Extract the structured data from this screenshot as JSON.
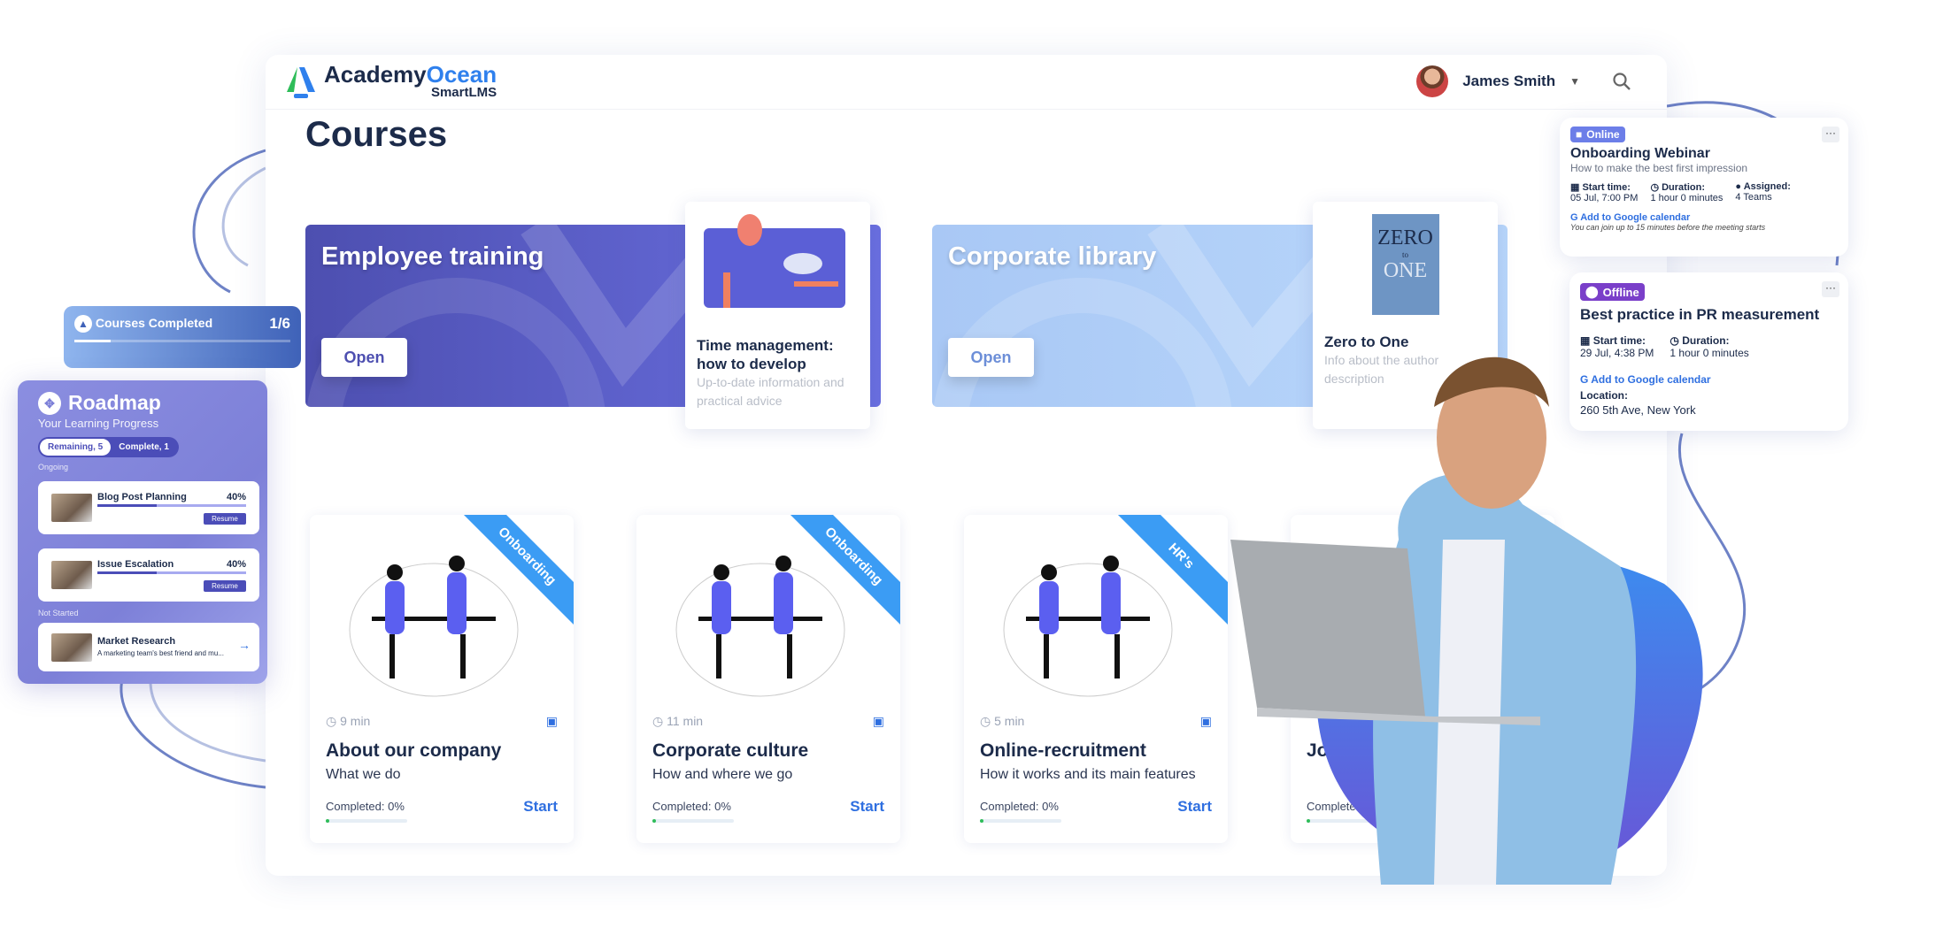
{
  "brand": {
    "name_a": "Academy",
    "name_b": "Ocean",
    "sub": "SmartLMS"
  },
  "header": {
    "user_name": "James Smith"
  },
  "page": {
    "title": "Courses"
  },
  "banners": [
    {
      "title": "Employee training",
      "open_label": "Open",
      "color": "#5b5fd6",
      "featured": {
        "title": "Time management: how to develop",
        "desc": "Up-to-date information and practical advice"
      }
    },
    {
      "title": "Corporate library",
      "open_label": "Open",
      "color": "#a9ccf7",
      "featured": {
        "title": "Zero to One",
        "desc": "Info about the author description",
        "cover_top": "ZERO",
        "cover_mid": "to",
        "cover_bottom": "ONE"
      }
    }
  ],
  "courses": [
    {
      "tag": "Onboarding",
      "duration": "9 min",
      "title": "About our company",
      "subtitle": "What we do",
      "completed": "Completed: 0%",
      "progress": 0,
      "action": "Start"
    },
    {
      "tag": "Onboarding",
      "duration": "11 min",
      "title": "Corporate culture",
      "subtitle": "How and where we go",
      "completed": "Completed: 0%",
      "progress": 0,
      "action": "Start"
    },
    {
      "tag": "HR's",
      "duration": "5 min",
      "title": "Online-recruitment",
      "subtitle": "How it works and its main features",
      "completed": "Completed: 0%",
      "progress": 0,
      "action": "Start"
    },
    {
      "title": "Job",
      "completed": "Completed: 0%",
      "progress": 0
    }
  ],
  "events": [
    {
      "badge": "Online",
      "badge_color": "#6c7ee8",
      "title": "Onboarding Webinar",
      "subtitle": "How to make the best first impression",
      "start_label": "Start time:",
      "start": "05 Jul, 7:00 PM",
      "duration_label": "Duration:",
      "duration": "1 hour 0 minutes",
      "assigned_label": "Assigned:",
      "assigned": "4 Teams",
      "gcal": "Add to Google calendar",
      "note": "You can join up to 15 minutes before the meeting starts"
    },
    {
      "badge": "Offline",
      "badge_color": "#7a3fc9",
      "title": "Best practice in PR measurement",
      "start_label": "Start time:",
      "start": "29 Jul, 4:38 PM",
      "duration_label": "Duration:",
      "duration": "1 hour 0 minutes",
      "gcal": "Add to Google calendar",
      "location_label": "Location:",
      "location": "260 5th Ave, New York"
    }
  ],
  "courses_completed": {
    "label": "Courses Completed",
    "value": "1/6",
    "progress": 0.1667
  },
  "roadmap": {
    "title": "Roadmap",
    "subtitle": "Your Learning Progress",
    "tabs": [
      "Remaining, 5",
      "Complete, 1"
    ],
    "ongoing_label": "Ongoing",
    "not_started_label": "Not Started",
    "ongoing": [
      {
        "name": "Blog Post Planning",
        "pct": "40%",
        "progress": 40,
        "action": "Resume"
      },
      {
        "name": "Issue Escalation",
        "pct": "40%",
        "progress": 40,
        "action": "Resume"
      }
    ],
    "not_started": [
      {
        "name": "Market Research",
        "desc": "A marketing team's best friend and mu..."
      }
    ]
  }
}
